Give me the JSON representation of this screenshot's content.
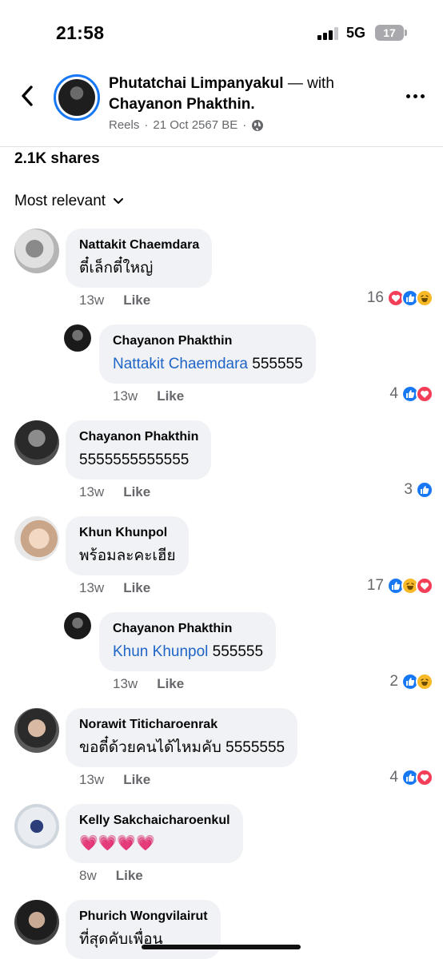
{
  "status_bar": {
    "time": "21:58",
    "network": "5G",
    "battery": "17"
  },
  "post": {
    "author": "Phutatchai Limpanyakul",
    "with_text": " — with ",
    "tagged": "Chayanon Phakthin.",
    "source": "Reels",
    "separator": "·",
    "date": "21 Oct 2567 BE",
    "shares": "2.1K shares"
  },
  "sort_label": "Most relevant",
  "like_label": "Like",
  "comments": [
    {
      "name": "Nattakit Chaemdara",
      "mention": "",
      "text": "ตี๋เล็กตี๋ใหญ่",
      "time": "13w",
      "count": "16",
      "reactions": [
        "love",
        "like",
        "haha"
      ]
    },
    {
      "name": "Chayanon Phakthin",
      "mention": "Nattakit Chaemdara",
      "text": " 555555",
      "time": "13w",
      "count": "4",
      "reactions": [
        "like",
        "love"
      ]
    },
    {
      "name": "Chayanon Phakthin",
      "mention": "",
      "text": "5555555555555",
      "time": "13w",
      "count": "3",
      "reactions": [
        "like"
      ]
    },
    {
      "name": "Khun Khunpol",
      "mention": "",
      "text": "พร้อมละคะเฮีย",
      "time": "13w",
      "count": "17",
      "reactions": [
        "like",
        "haha",
        "love"
      ]
    },
    {
      "name": "Chayanon Phakthin",
      "mention": "Khun Khunpol",
      "text": " 555555",
      "time": "13w",
      "count": "2",
      "reactions": [
        "like",
        "haha"
      ]
    },
    {
      "name": "Norawit Titicharoenrak",
      "mention": "",
      "text": "ขอตี๋ด้วยคนได้ไหมคับ 5555555",
      "time": "13w",
      "count": "4",
      "reactions": [
        "like",
        "love"
      ]
    },
    {
      "name": "Kelly Sakchaicharoenkul",
      "mention": "",
      "text": "💗💗💗💗",
      "time": "8w",
      "count": "",
      "reactions": []
    },
    {
      "name": "Phurich Wongvilairut",
      "mention": "",
      "text": "ที่สุดคับเพื่อน",
      "time": "",
      "count": "",
      "reactions": []
    }
  ],
  "colors": {
    "accent": "#1877f2",
    "bubble": "#f0f2f5",
    "mention": "#1f65c7",
    "love": "#f33e58",
    "haha": "#f7b928"
  }
}
